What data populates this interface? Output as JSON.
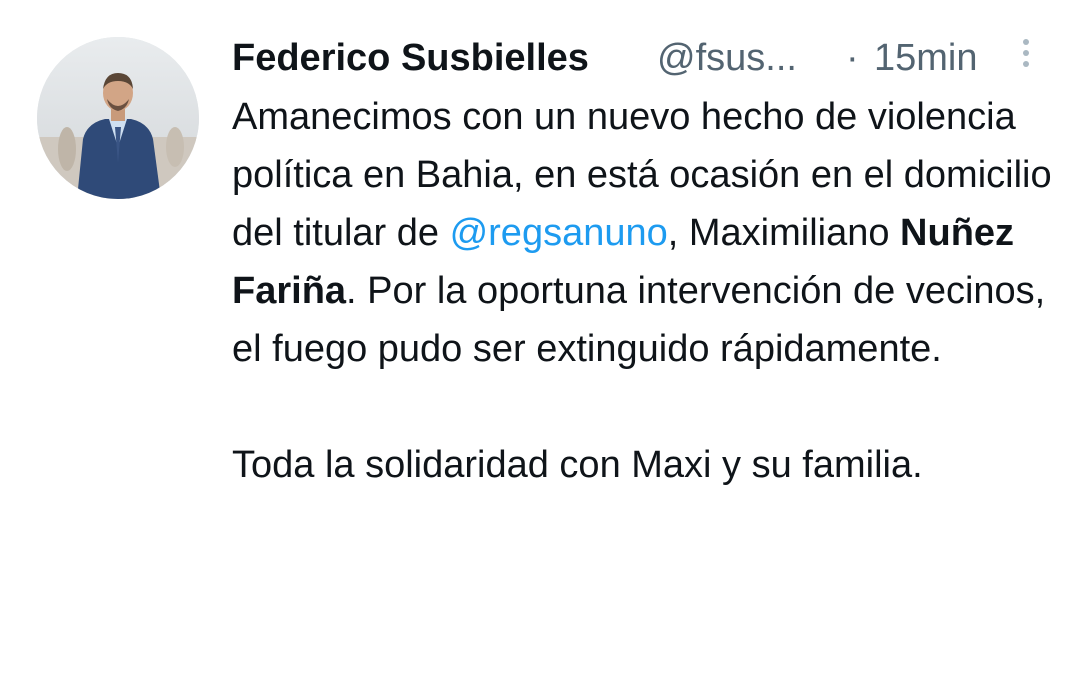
{
  "tweet": {
    "author": {
      "display_name": "Federico Susbielles",
      "handle": "@fsus...",
      "avatar_icon": "profile-photo"
    },
    "separator": "·",
    "timestamp": "15min",
    "more_icon": "vertical-dots-icon",
    "body": {
      "p1_text_1": "Amanecimos con un nuevo hecho de violencia política en Bahia, en está ocasión en el domicilio del titular de ",
      "mention": "@regsanuno",
      "p1_text_2": ", Maximiliano ",
      "bold_name": "Nuñez Fariña",
      "p1_text_3": ". Por la oportuna intervención de vecinos, el fuego pudo ser extinguido rápidamente.",
      "p2": "Toda la solidaridad con Maxi y su familia."
    }
  },
  "colors": {
    "text": "#0f1419",
    "secondary": "#536471",
    "link": "#1d9bf0",
    "background": "#ffffff"
  }
}
